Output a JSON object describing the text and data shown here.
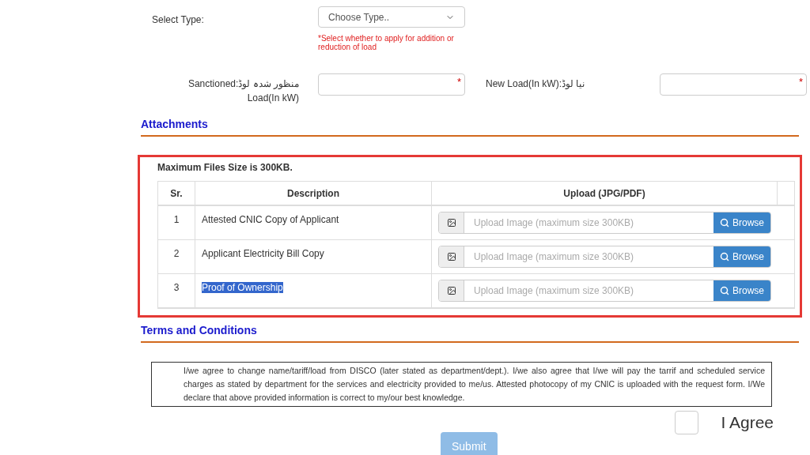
{
  "select_type": {
    "label": "Select Type:",
    "placeholder": "Choose Type..",
    "hint": "*Select whether to apply for addition or reduction of load"
  },
  "load_fields": [
    {
      "label": "منظور شدہ لوڈ:Sanctioned Load(In kW)",
      "required_mark": "*"
    },
    {
      "label": "نیا لوڈ:New Load(In kW)",
      "required_mark": "*"
    }
  ],
  "attachments": {
    "heading": "Attachments",
    "note": "Maximum Files Size is 300KB.",
    "columns": [
      "Sr.",
      "Description",
      "Upload (JPG/PDF)"
    ],
    "rows": [
      {
        "sr": "1",
        "description": "Attested CNIC Copy of Applicant",
        "placeholder": "Upload Image (maximum size 300KB)",
        "button": "Browse",
        "highlighted": false
      },
      {
        "sr": "2",
        "description": "Applicant Electricity Bill Copy",
        "placeholder": "Upload Image (maximum size 300KB)",
        "button": "Browse",
        "highlighted": false
      },
      {
        "sr": "3",
        "description": "Proof of Ownership",
        "placeholder": "Upload Image (maximum size 300KB)",
        "button": "Browse",
        "highlighted": true
      }
    ]
  },
  "terms": {
    "heading": "Terms and Conditions",
    "text": "I/we agree to change name/tariff/load from DISCO (later stated as department/dept.). I/we also agree that I/we will pay the tarrif and scheduled service charges as stated by department for the services and electricity provided to me/us. Attested photocopy of my CNIC is uploaded with the request form. I/We declare that above provided information is correct to my/our best knowledge.",
    "agree_label": "I Agree",
    "checked": false
  },
  "submit": {
    "label": "Submit",
    "disabled": true
  }
}
